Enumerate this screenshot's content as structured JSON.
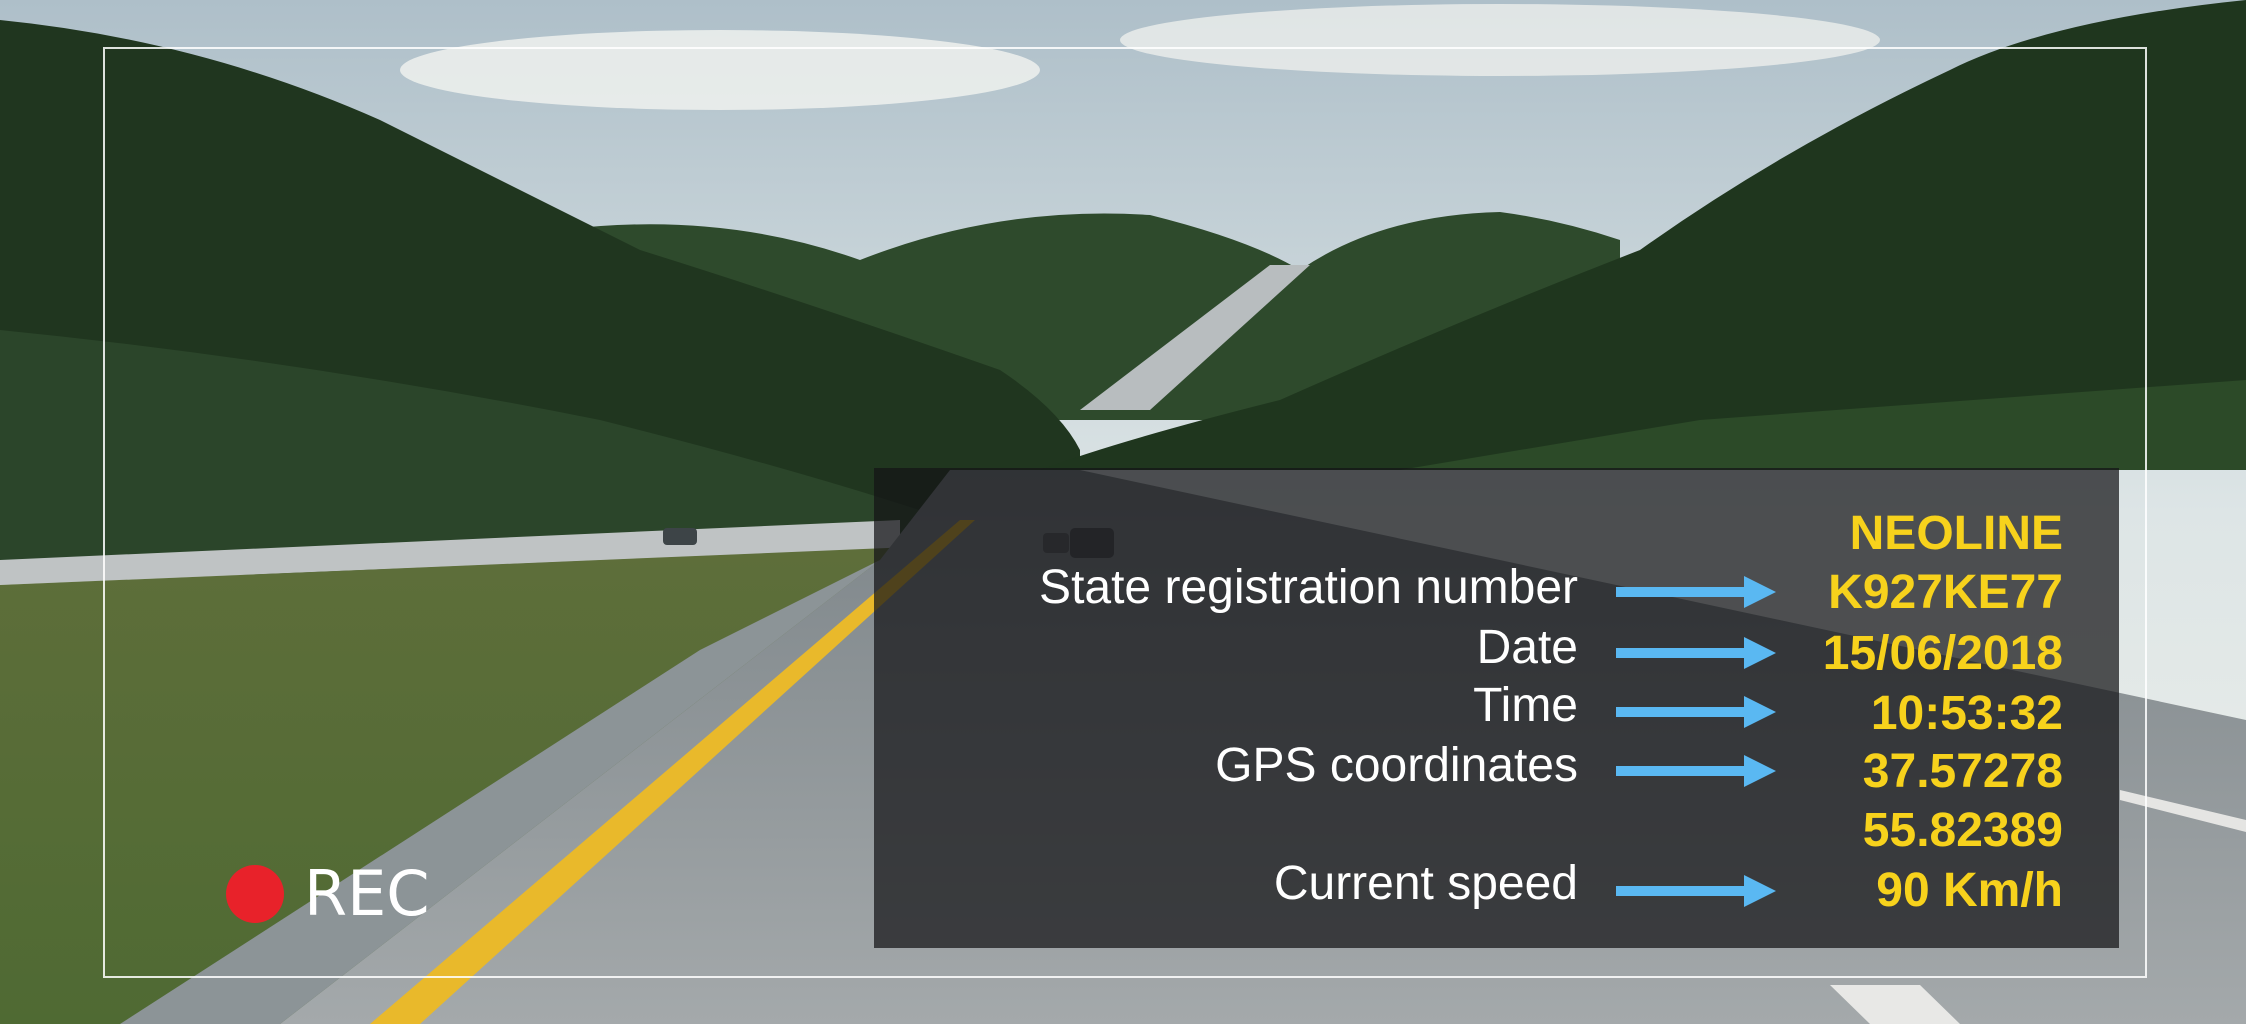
{
  "overlay": {
    "brand": "NEOLINE",
    "rows": [
      {
        "label": "State registration number",
        "value": "K927KE77"
      },
      {
        "label": "Date",
        "value": "15/06/2018"
      },
      {
        "label": "Time",
        "value": "10:53:32"
      },
      {
        "label": "GPS coordinates",
        "value": "37.57278"
      },
      {
        "label": "",
        "value": "55.82389"
      },
      {
        "label": "Current speed",
        "value": "90 Km/h"
      }
    ]
  },
  "recording": {
    "label": "REC",
    "indicator_color": "#e8222a"
  },
  "colors": {
    "value_text": "#f7d21c",
    "arrow": "#5ab8f2",
    "label_text": "#ffffff"
  }
}
